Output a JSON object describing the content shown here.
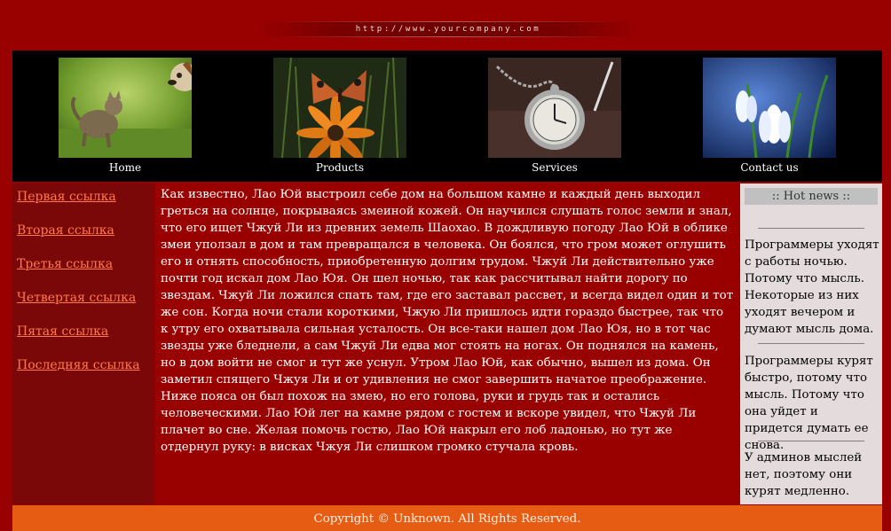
{
  "header": {
    "url": "http://www.yourcompany.com"
  },
  "nav": {
    "items": [
      {
        "label": "Home",
        "image": "kitten-and-dog-photo"
      },
      {
        "label": "Products",
        "image": "butterfly-on-flower-photo"
      },
      {
        "label": "Services",
        "image": "pocket-watch-photo"
      },
      {
        "label": "Contact us",
        "image": "snowdrop-flower-photo"
      }
    ]
  },
  "sidebar": {
    "links": [
      {
        "label": "Первая ссылка"
      },
      {
        "label": "Вторая ссылка"
      },
      {
        "label": "Третья ссылка"
      },
      {
        "label": "Четвертая ссылка"
      },
      {
        "label": "Пятая ссылка"
      },
      {
        "label": "Последняя ссылка"
      }
    ]
  },
  "main": {
    "text": "Как известно, Лао Юй выстроил себе дом на большом камне и каждый день выходил греться на солнце, покрываясь змеиной кожей. Он научился слушать голос земли и знал, что его ищет Чжуй Ли из древних земель Шаохао. В дождливую погоду Лао Юй в облике змеи уползал в дом и там превращался в человека. Он боялся, что гром может оглушить его и отнять способность, приобретенную долгим трудом. Чжуй Ли действительно уже почти год искал дом Лао Юя. Он шел ночью, так как рассчитывал найти дорогу по звездам. Чжуй Ли ложился спать там, где его заставал рассвет, и всегда видел один и тот же сон. Когда ночи стали короткими, Чжую Ли пришлось идти гораздо быстрее, так что к утру его охватывала сильная усталость. Он все-таки нашел дом Лао Юя, но в тот час звезды уже бледнели, а сам Чжуй Ли едва мог стоять на ногах. Он поднялся на камень, но в дом войти не смог и тут же уснул. Утром Лао Юй, как обычно, вышел из дома. Он заметил спящего Чжуя Ли и от удивления не смог завершить начатое преображение. Ниже пояса он был похож на змею, но его голова, руки и грудь так и остались человеческими. Лао Юй лег на камне рядом с гостем и вскоре увидел, что Чжуй Ли плачет во сне. Желая помочь гостю, Лао Юй накрыл его лоб ладонью, но тут же отдернул руку: в висках Чжуя Ли слишком громко стучала кровь."
  },
  "news": {
    "title": ":: Hot news ::",
    "items": [
      "Программеры уходят с работы ночью. Потому что мысль. Некоторые из них уходят вечером и думают мысль дома.",
      "Программеры курят быстро, потому что мысль. Потому что она уйдет и придется думать ее снова.",
      "У админов мыслей нет, поэтому они курят медленно."
    ]
  },
  "footer": {
    "text": "Copyright © Unknown. All Rights Reserved."
  },
  "colors": {
    "page_bg": "#990000",
    "header_bg": "#000000",
    "sidebar_bg": "#7a0808",
    "link": "#ff7a4d",
    "news_bg": "#e4dcdc",
    "footer_bg": "#e65c12"
  }
}
